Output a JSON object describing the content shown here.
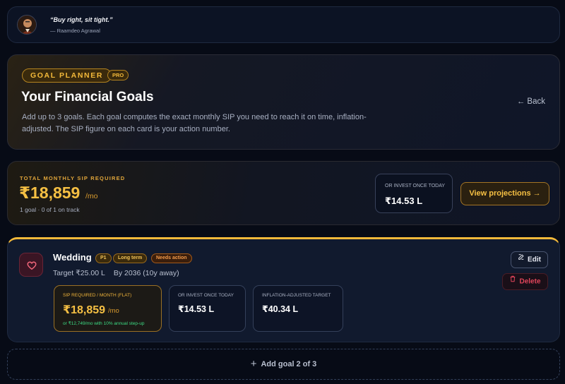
{
  "quote": {
    "text": "“Buy right, sit tight.”",
    "author": "— Raamdeo Agrawal"
  },
  "hero": {
    "badge": "GOAL PLANNER",
    "pro_badge": "PRO",
    "title": "Your Financial Goals",
    "description": "Add up to 3 goals. Each goal computes the exact monthly SIP you need to reach it on time, inflation-adjusted. The SIP figure on each card is your action number.",
    "back_label": "← Back"
  },
  "summary": {
    "label": "TOTAL MONTHLY SIP REQUIRED",
    "amount": "₹18,859",
    "unit": "/mo",
    "subtext": "1 goal · 0 of 1 on track",
    "invest_once_label": "OR INVEST ONCE TODAY",
    "invest_once_value": "₹14.53 L",
    "projections_button": "View projections →"
  },
  "goal": {
    "icon": "heart-icon",
    "name": "Wedding",
    "tags": {
      "priority": "P1",
      "term": "Long term",
      "status": "Needs action"
    },
    "target": "Target ₹25.00 L",
    "by": "By 2036 (10y away)",
    "metrics": {
      "sip_label": "SIP REQUIRED / MONTH (FLAT)",
      "sip_value": "₹18,859",
      "sip_unit": "/mo",
      "sip_note": "or ₹12,749/mo with 10% annual step-up",
      "once_label": "OR INVEST ONCE TODAY",
      "once_value": "₹14.53 L",
      "inflation_label": "INFLATION-ADJUSTED TARGET",
      "inflation_value": "₹40.34 L"
    },
    "edit_label": "Edit",
    "delete_label": "Delete"
  },
  "add_goal": {
    "label": "Add goal 2 of 3"
  },
  "colors": {
    "accent_gold": "#f6c043",
    "danger": "#e0455a",
    "success": "#3ddc84",
    "background": "#070b16"
  }
}
